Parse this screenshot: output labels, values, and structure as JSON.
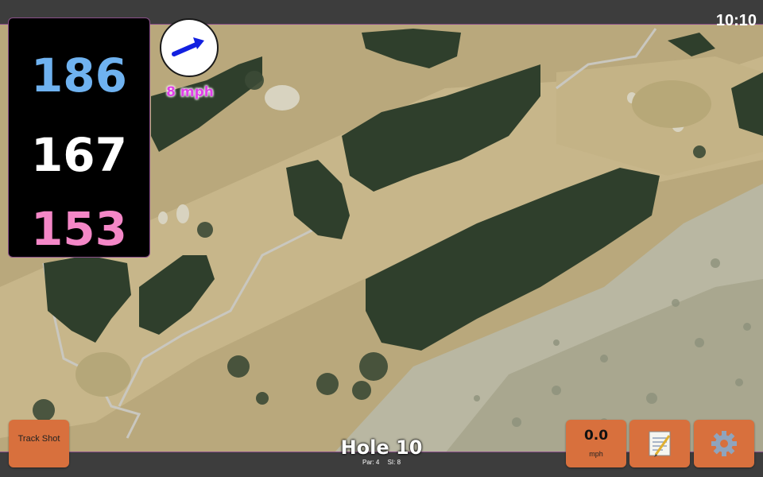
{
  "status_bar": {
    "time": "10:10"
  },
  "distances": {
    "back": "186",
    "center": "167",
    "front": "153"
  },
  "wind": {
    "speed": "8 mph",
    "icon": "wind-arrow-icon"
  },
  "buttons": {
    "track_shot": "Track Shot",
    "speed_value": "0.0",
    "speed_unit": "mph",
    "notes_icon": "notepad-icon",
    "settings_icon": "gear-icon"
  },
  "hole": {
    "title": "Hole 10",
    "par": "Par: 4",
    "si": "SI: 8"
  },
  "colors": {
    "back_distance": "#6fb2f0",
    "center_distance": "#ffffff",
    "front_distance": "#f487c7",
    "wind_text": "#e040e8",
    "button_orange": "#d8703d",
    "bar_gray": "#3d3d3d"
  }
}
